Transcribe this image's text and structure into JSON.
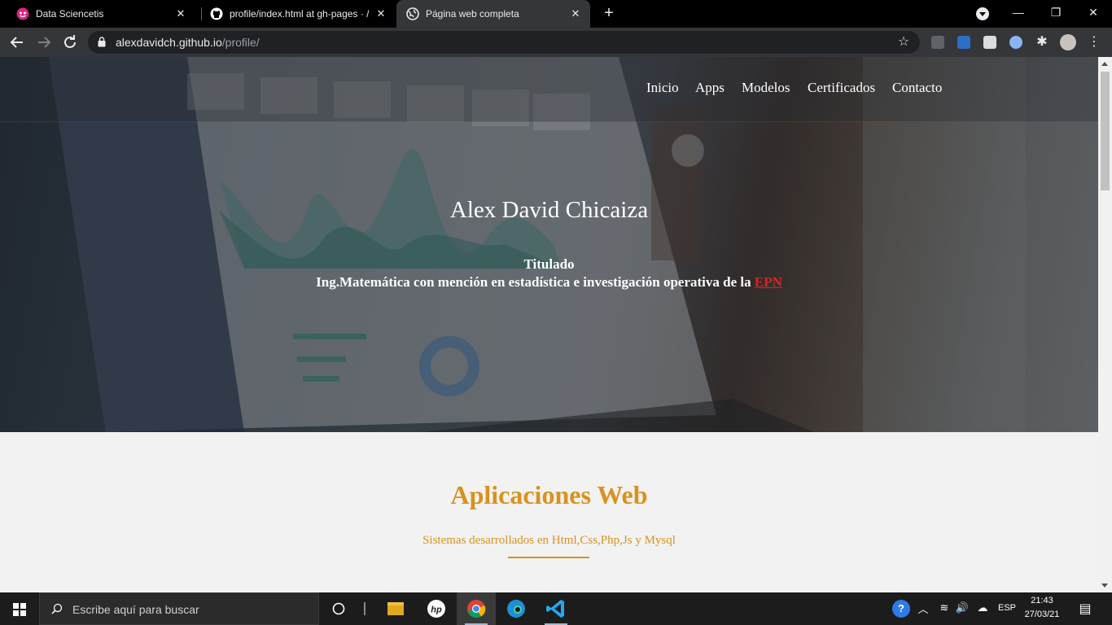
{
  "browser": {
    "tabs": [
      {
        "title": "Data Sciencetis",
        "active": false
      },
      {
        "title": "profile/index.html at gh-pages · /",
        "active": false
      },
      {
        "title": "Página web completa",
        "active": true
      }
    ],
    "new_tab_label": "+",
    "close_glyph": "✕",
    "url": {
      "host": "alexdavidch.github.io",
      "path": "/profile/"
    },
    "icons": [
      "back-icon",
      "forward-icon",
      "reload-icon",
      "lock-icon",
      "star-icon",
      "extensions-icon",
      "menu-icon"
    ]
  },
  "page": {
    "nav": [
      "Inicio",
      "Apps",
      "Modelos",
      "Certificados",
      "Contacto"
    ],
    "hero": {
      "name": "Alex David Chicaiza",
      "line1": "Titulado",
      "line2_prefix": "Ing.Matemática con mención en estadística e investigación operativa de la ",
      "line2_link": "EPN"
    },
    "section": {
      "title": "Aplicaciones Web",
      "subtitle": "Sistemas desarrollados en Html,Css,Php,Js y Mysql"
    },
    "colors": {
      "accent": "#d8921e",
      "link": "#e02020"
    }
  },
  "taskbar": {
    "search_placeholder": "Escribe aquí para buscar",
    "language": "ESP",
    "time": "21:43",
    "date": "27/03/21"
  }
}
